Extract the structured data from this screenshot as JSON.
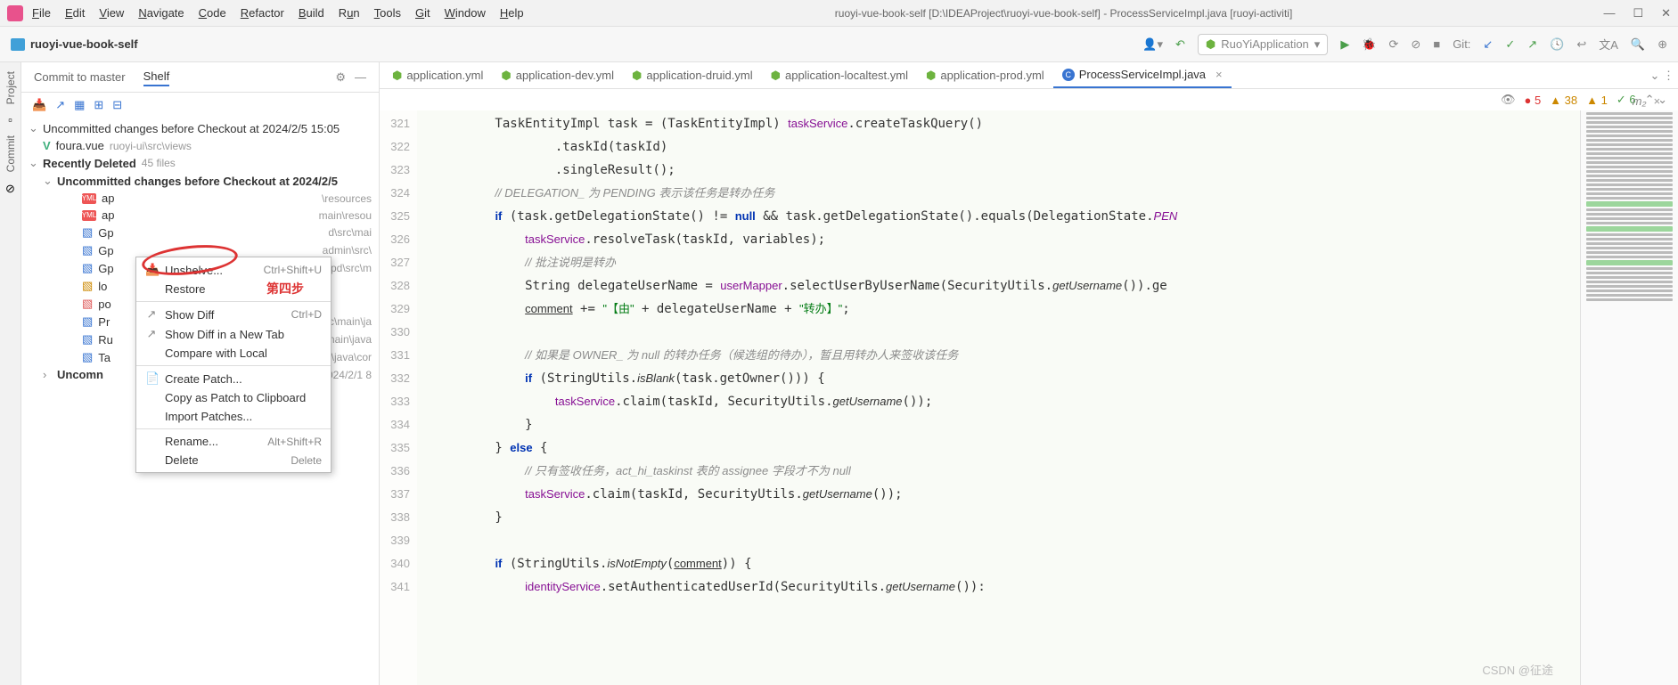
{
  "window": {
    "title": "ruoyi-vue-book-self [D:\\IDEAProject\\ruoyi-vue-book-self] - ProcessServiceImpl.java [ruoyi-activiti]"
  },
  "menu": [
    "File",
    "Edit",
    "View",
    "Navigate",
    "Code",
    "Refactor",
    "Build",
    "Run",
    "Tools",
    "Git",
    "Window",
    "Help"
  ],
  "project_name": "ruoyi-vue-book-self",
  "run_config": "RuoYiApplication",
  "git_label": "Git:",
  "left_strip": {
    "project": "Project",
    "commit": "Commit"
  },
  "commit_panel": {
    "tab_commit": "Commit to master",
    "tab_shelf": "Shelf",
    "tree": {
      "uncommitted_before": "Uncommitted changes before Checkout at 2024/2/5 15:05",
      "foura_file": "foura.vue",
      "foura_path": "ruoyi-ui\\src\\views",
      "recently_deleted": "Recently Deleted",
      "recently_deleted_count": "45 files",
      "uncommitted_nested": "Uncommitted changes before Checkout at 2024/2/5",
      "files": [
        {
          "name": "ap",
          "path": "\\resources"
        },
        {
          "name": "ap",
          "path": "main\\resou"
        },
        {
          "name": "Gp",
          "path": "d\\src\\mai"
        },
        {
          "name": "Gp",
          "path": "admin\\src\\"
        },
        {
          "name": "Gp",
          "path": "gpd\\src\\m"
        },
        {
          "name": "lo",
          "path": ""
        },
        {
          "name": "po",
          "path": ""
        },
        {
          "name": "Pr",
          "path": "rc\\main\\ja"
        },
        {
          "name": "Ru",
          "path": "\\main\\java"
        },
        {
          "name": "Ta",
          "path": "on\\java\\cor"
        }
      ],
      "uncommitted_last": "Uncomn",
      "uncommitted_last_date": "024/2/1 8"
    }
  },
  "context_menu": {
    "unshelve": "Unshelve...",
    "unshelve_sc": "Ctrl+Shift+U",
    "restore": "Restore",
    "show_diff": "Show Diff",
    "show_diff_sc": "Ctrl+D",
    "show_diff_tab": "Show Diff in a New Tab",
    "compare_local": "Compare with Local",
    "create_patch": "Create Patch...",
    "copy_patch": "Copy as Patch to Clipboard",
    "import_patches": "Import Patches...",
    "rename": "Rename...",
    "rename_sc": "Alt+Shift+R",
    "delete": "Delete",
    "delete_sc": "Delete"
  },
  "annotation": "第四步",
  "editor_tabs": [
    {
      "label": "application.yml",
      "active": false
    },
    {
      "label": "application-dev.yml",
      "active": false
    },
    {
      "label": "application-druid.yml",
      "active": false
    },
    {
      "label": "application-localtest.yml",
      "active": false
    },
    {
      "label": "application-prod.yml",
      "active": false
    },
    {
      "label": "ProcessServiceImpl.java",
      "active": true
    }
  ],
  "inspections": {
    "errors": "5",
    "warnings_a": "38",
    "warnings_b": "1",
    "ok": "6"
  },
  "memory": "m₂",
  "code": {
    "lines": [
      "321",
      "322",
      "323",
      "324",
      "325",
      "326",
      "327",
      "328",
      "329",
      "330",
      "331",
      "332",
      "333",
      "334",
      "335",
      "336",
      "337",
      "338",
      "339",
      "340",
      "341"
    ],
    "l321": "        TaskEntityImpl task = (TaskEntityImpl) taskService.createTaskQuery()",
    "l322": "                .taskId(taskId)",
    "l323": "                .singleResult();",
    "l324": "        // DELEGATION_ 为 PENDING 表示该任务是转办任务",
    "l325": "        if (task.getDelegationState() != null && task.getDelegationState().equals(DelegationState.PEN",
    "l326": "            taskService.resolveTask(taskId, variables);",
    "l327": "            // 批注说明是转办",
    "l328": "            String delegateUserName = userMapper.selectUserByUserName(SecurityUtils.getUsername()).ge",
    "l329": "            comment += \"【由\" + delegateUserName + \"转办】\";",
    "l330": "",
    "l331": "            // 如果是 OWNER_ 为 null 的转办任务（候选组的待办），暂且用转办人来签收该任务",
    "l332": "            if (StringUtils.isBlank(task.getOwner())) {",
    "l333": "                taskService.claim(taskId, SecurityUtils.getUsername());",
    "l334": "            }",
    "l335": "        } else {",
    "l336": "            // 只有签收任务，act_hi_taskinst 表的 assignee 字段才不为 null",
    "l337": "            taskService.claim(taskId, SecurityUtils.getUsername());",
    "l338": "        }",
    "l339": "",
    "l340": "        if (StringUtils.isNotEmpty(comment)) {",
    "l341": "            identityService.setAuthenticatedUserId(SecurityUtils.getUsername()):"
  },
  "watermark": "CSDN @征途"
}
